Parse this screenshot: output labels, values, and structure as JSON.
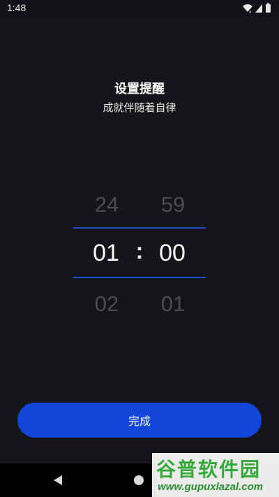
{
  "status_bar": {
    "time": "1:48",
    "icons": [
      "wifi-icon",
      "signal-icon",
      "battery-icon"
    ]
  },
  "header": {
    "title": "设置提醒",
    "subtitle": "成就伴随着自律"
  },
  "time_picker": {
    "hours": {
      "above": "24",
      "selected": "01",
      "below": "02"
    },
    "minutes": {
      "above": "59",
      "selected": "00",
      "below": "01"
    },
    "separator": ":"
  },
  "actions": {
    "done_label": "完成"
  },
  "nav_bar": {
    "icons": [
      "back-icon",
      "home-icon"
    ]
  },
  "watermark": {
    "name": "谷普软件园",
    "url": "www.gupuxlazal.com"
  },
  "colors": {
    "background": "#141519",
    "accent": "#1146d8",
    "selection_line": "#1f4fd1",
    "dim_text": "#4a4c53"
  }
}
